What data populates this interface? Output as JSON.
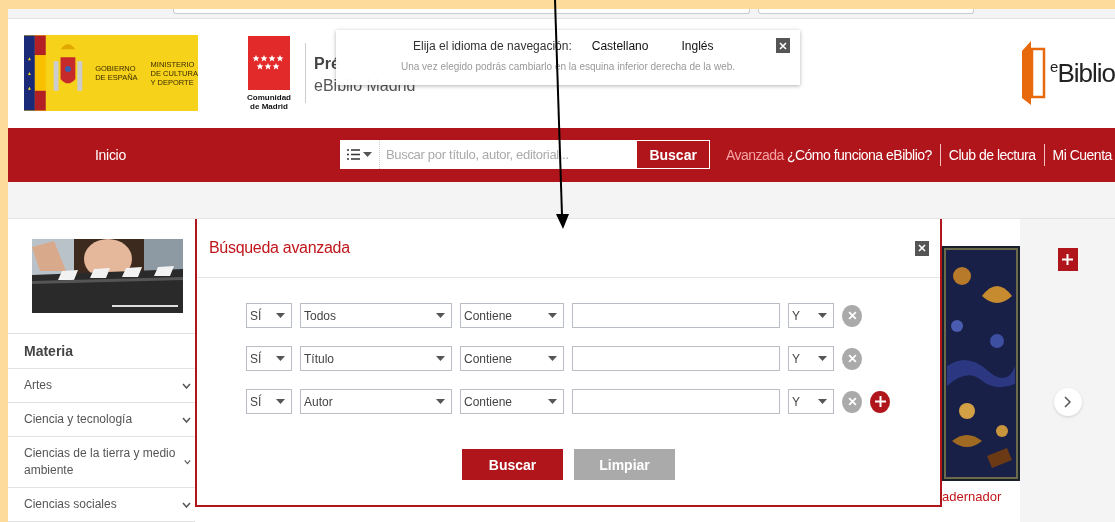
{
  "header": {
    "government_logo": {
      "government": "GOBIERNO DE ESPAÑA",
      "ministry": "MINISTERIO DE CULTURA Y DEPORTE"
    },
    "region_logo": "Comunidad de Madrid",
    "title": "Pré",
    "subtitle": "eBiblio Madrid",
    "brand_logo": "$^{e}$Biblio"
  },
  "language_popup": {
    "prompt": "Elija el idioma de navegación:",
    "options": [
      {
        "label": "Castellano"
      },
      {
        "label": "Inglés"
      }
    ],
    "note": "Una vez elegido podrás cambiarlo en la esquina inferior derecha de la web."
  },
  "nav": {
    "home": "Inicio",
    "search": {
      "placeholder": "Buscar por título, autor, editorial...",
      "button": "Buscar"
    },
    "links": [
      {
        "label": "Avanzada",
        "kind": "accent"
      },
      {
        "label": "¿Cómo funciona eBiblio?",
        "kind": "plain"
      },
      {
        "label": "Club de lectura",
        "kind": "separated"
      },
      {
        "label": "Mi Cuenta",
        "kind": "separated"
      }
    ]
  },
  "sidebar": {
    "heading": "Materia",
    "items": [
      {
        "label": "Artes"
      },
      {
        "label": "Ciencia y tecnología"
      },
      {
        "label": "Ciencias de la tierra y medio ambiente"
      },
      {
        "label": "Ciencias sociales"
      }
    ]
  },
  "modal": {
    "title": "Búsqueda avanzada",
    "rows": [
      {
        "negation": "SÍ",
        "field": "Todos",
        "operator": "Contiene",
        "connector": "Y",
        "can_add": false
      },
      {
        "negation": "SÍ",
        "field": "Título",
        "operator": "Contiene",
        "connector": "Y",
        "can_add": false
      },
      {
        "negation": "SÍ",
        "field": "Autor",
        "operator": "Contiene",
        "connector": "Y",
        "can_add": true
      }
    ],
    "buttons": [
      {
        "label": "Buscar",
        "kind": "primary"
      },
      {
        "label": "Limpiar",
        "kind": "secondary"
      }
    ]
  },
  "carousel": {
    "book_title": "adernador"
  }
}
